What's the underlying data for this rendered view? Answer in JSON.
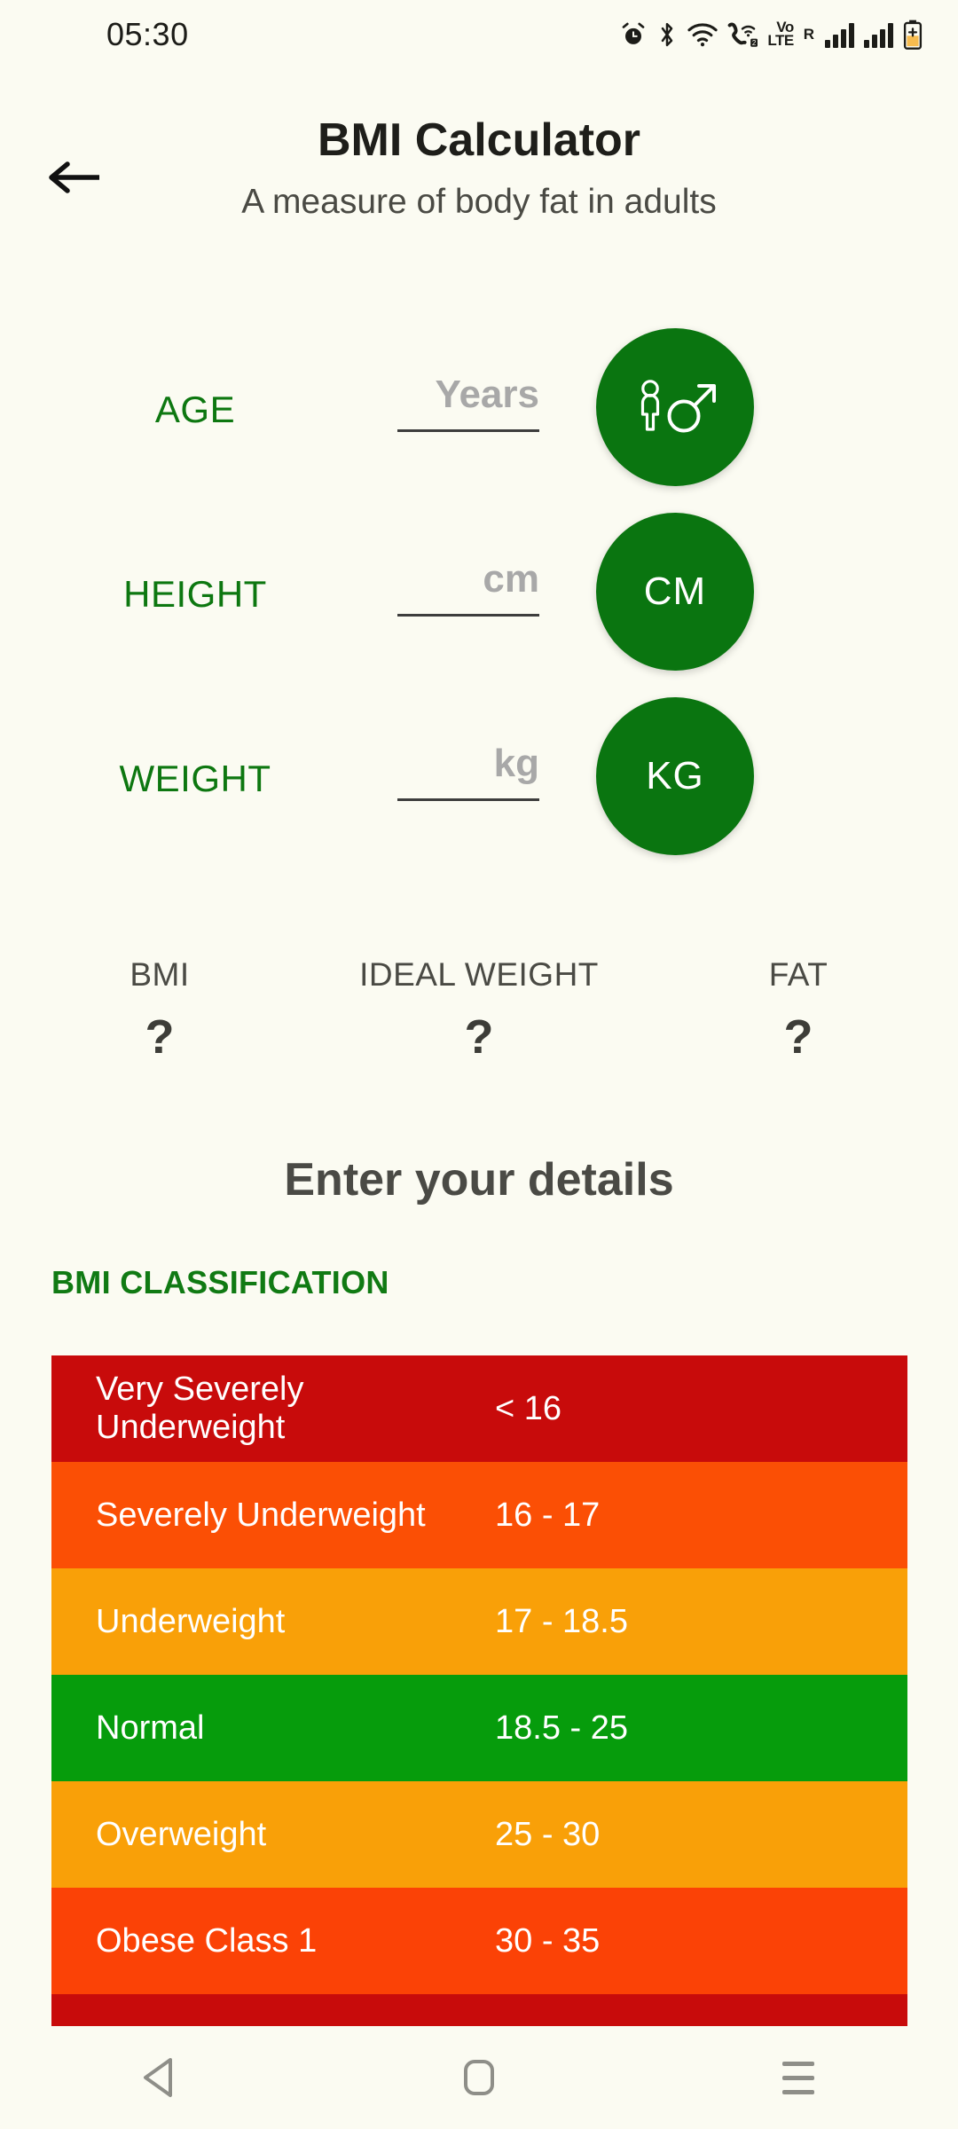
{
  "status_bar": {
    "clock": "05:30",
    "icons": [
      "alarm-icon",
      "bluetooth-icon",
      "wifi-icon",
      "call-wifi-icon",
      "volte-icon",
      "roaming-icon",
      "signal-bars-1-icon",
      "signal-bars-2-icon",
      "battery-icon"
    ],
    "volte_top": "Vo",
    "volte_bottom": "LTE",
    "roaming_letter": "R",
    "sim_badge": "2"
  },
  "header": {
    "back_icon": "back-arrow-icon",
    "title": "BMI Calculator",
    "subtitle": "A measure of body fat in adults"
  },
  "inputs": [
    {
      "label": "AGE",
      "placeholder": "Years",
      "value": "",
      "unit": "",
      "unit_icon": "male-gender-icon"
    },
    {
      "label": "HEIGHT",
      "placeholder": "cm",
      "value": "",
      "unit": "CM",
      "unit_icon": ""
    },
    {
      "label": "WEIGHT",
      "placeholder": "kg",
      "value": "",
      "unit": "KG",
      "unit_icon": ""
    }
  ],
  "results": {
    "bmi_label": "BMI",
    "bmi_value": "?",
    "ideal_label": "IDEAL WEIGHT",
    "ideal_value": "?",
    "fat_label": "FAT",
    "fat_value": "?"
  },
  "prompt": "Enter your details",
  "classification": {
    "heading": "BMI CLASSIFICATION",
    "rows": [
      {
        "category": "Very Severely Underweight",
        "range": "< 16",
        "color": "#c80b0b"
      },
      {
        "category": "Severely Underweight",
        "range": "16 - 17",
        "color": "#fb4f05"
      },
      {
        "category": "Underweight",
        "range": "17 - 18.5",
        "color": "#f9a008"
      },
      {
        "category": "Normal",
        "range": "18.5 - 25",
        "color": "#069c0c"
      },
      {
        "category": "Overweight",
        "range": "25 - 30",
        "color": "#f9a008"
      },
      {
        "category": "Obese Class 1",
        "range": "30 - 35",
        "color": "#fb4206"
      },
      {
        "category": "",
        "range": "",
        "color": "#c80b0b"
      }
    ]
  },
  "nav_bar": {
    "back_icon": "nav-back-triangle-icon",
    "home_icon": "nav-home-square-icon",
    "recents_icon": "nav-recents-hamburger-icon"
  },
  "theme": {
    "background": "#fbfbf2",
    "accent_green": "#0a7510",
    "label_green": "#0d7710",
    "text_dark": "#1e1e1a",
    "text_muted": "#4a4a44",
    "placeholder_grey": "#a8a8a8"
  }
}
